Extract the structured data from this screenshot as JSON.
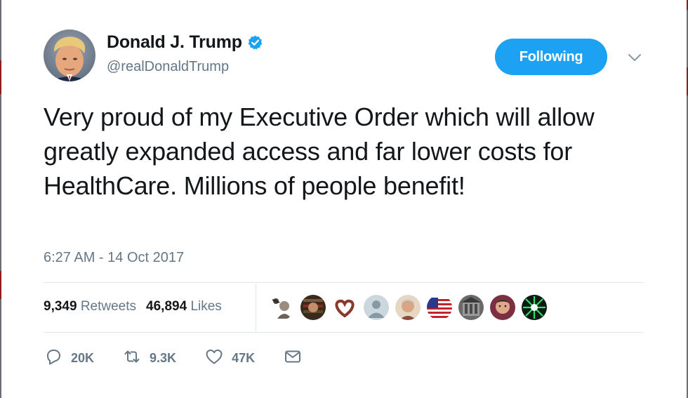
{
  "author": {
    "display_name": "Donald J. Trump",
    "handle": "@realDonaldTrump",
    "verified": true
  },
  "follow_button": {
    "label": "Following"
  },
  "tweet": {
    "text": "Very proud of my Executive Order which will allow greatly expanded access and far lower costs for HealthCare. Millions of people benefit!",
    "timestamp": "6:27 AM - 14 Oct 2017"
  },
  "stats": {
    "retweets_count": "9,349",
    "retweets_label": "Retweets",
    "likes_count": "46,894",
    "likes_label": "Likes"
  },
  "actions": {
    "reply_count": "20K",
    "retweet_count": "9.3K",
    "like_count": "47K"
  },
  "colors": {
    "accent": "#1da1f2",
    "text": "#14171a",
    "muted": "#657786",
    "divider": "#e1e8ed"
  },
  "icons": [
    "verified-badge-icon",
    "chevron-down-icon",
    "reply-icon",
    "retweet-icon",
    "heart-icon",
    "direct-message-icon"
  ]
}
